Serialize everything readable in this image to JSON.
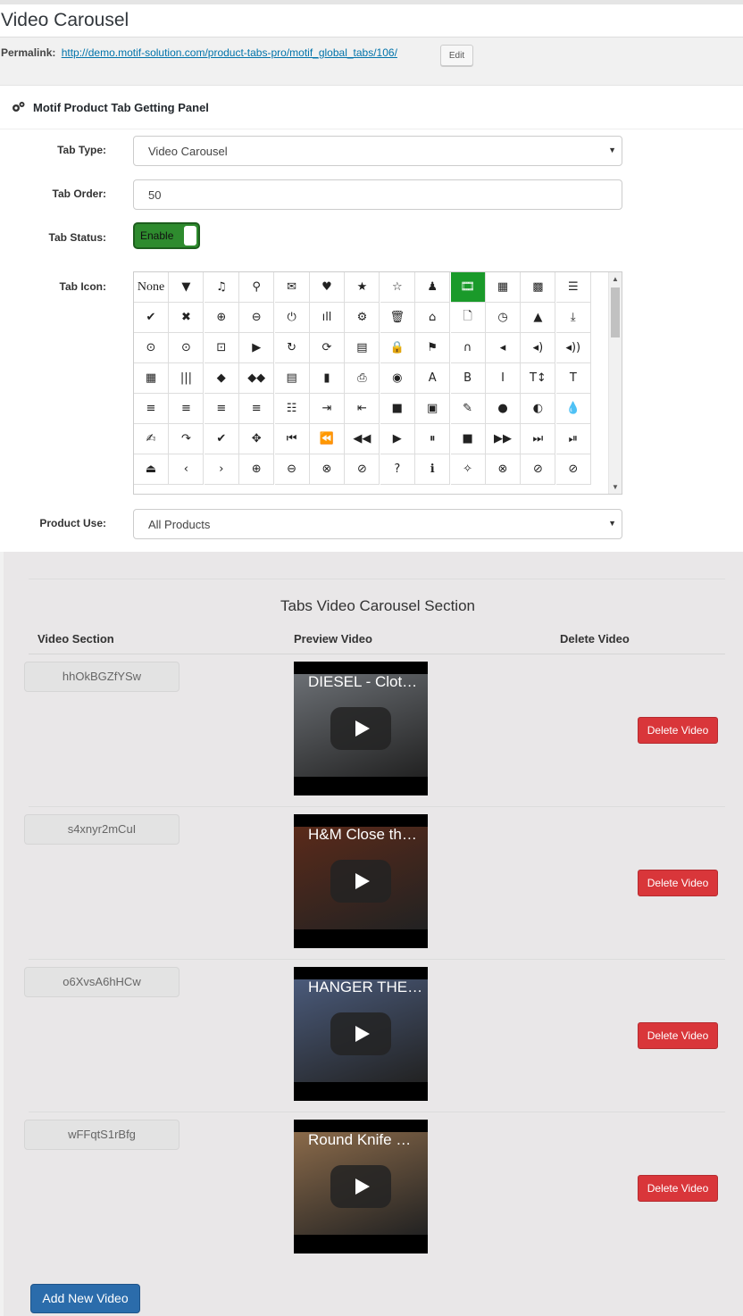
{
  "page_title": "Video Carousel",
  "permalink": {
    "label": "Permalink:",
    "url": "http://demo.motif-solution.com/product-tabs-pro/motif_global_tabs/106/",
    "edit": "Edit"
  },
  "panel_title": "Motif Product Tab Getting Panel",
  "form": {
    "tab_type_label": "Tab Type:",
    "tab_type_value": "Video Carousel",
    "tab_order_label": "Tab Order:",
    "tab_order_value": "50",
    "tab_status_label": "Tab Status:",
    "tab_status_value": "Enable",
    "tab_icon_label": "Tab Icon:",
    "product_use_label": "Product Use:",
    "product_use_value": "All Products"
  },
  "icons": [
    [
      "None",
      "▼",
      "♫",
      "⚲",
      "✉",
      "♥",
      "★",
      "☆",
      "♟",
      "🎞",
      "▦",
      "▩",
      "☰"
    ],
    [
      "✔",
      "✖",
      "⊕",
      "⊖",
      "⏻",
      "ıll",
      "⚙",
      "🗑",
      "⌂",
      "🗋",
      "◷",
      "▲",
      "⤓"
    ],
    [
      "⊙",
      "⊙",
      "⊡",
      "▶",
      "↻",
      "⟳",
      "▤",
      "🔒",
      "⚑",
      "∩",
      "◂",
      "◂)",
      "◂))"
    ],
    [
      "▦",
      "|||",
      "◆",
      "◆◆",
      "▤",
      "▮",
      "⎙",
      "◉",
      "A",
      "B",
      "I",
      "T↕",
      "T"
    ],
    [
      "≡",
      "≡",
      "≡",
      "≡",
      "☷",
      "⇥",
      "⇤",
      "■",
      "▣",
      "✎",
      "●",
      "◐",
      "💧"
    ],
    [
      "✍",
      "↷",
      "✔",
      "✥",
      "⏮",
      "⏪",
      "◀◀",
      "▶",
      "⏸",
      "■",
      "▶▶",
      "⏭",
      "⏯"
    ],
    [
      "⏏",
      "‹",
      "›",
      "⊕",
      "⊖",
      "⊗",
      "⊘",
      "?",
      "ℹ",
      "✧",
      "⊗",
      "⊘",
      "⊘"
    ]
  ],
  "selected_icon": "🎞",
  "video_section": {
    "title": "Tabs Video Carousel Section",
    "col_video": "Video Section",
    "col_preview": "Preview Video",
    "col_delete": "Delete Video",
    "rows": [
      {
        "id": "hhOkBGZfYSw",
        "caption": "DIESEL - Clot…",
        "delete": "Delete Video",
        "bg": "#6b6f74"
      },
      {
        "id": "s4xnyr2mCuI",
        "caption": "H&M Close th…",
        "delete": "Delete Video",
        "bg": "#5a2a1a"
      },
      {
        "id": "o6XvsA6hHCw",
        "caption": "HANGER THE…",
        "delete": "Delete Video",
        "bg": "#4a5a7a"
      },
      {
        "id": "wFFqtS1rBfg",
        "caption": "Round Knife …",
        "delete": "Delete Video",
        "bg": "#8a6a4a"
      }
    ],
    "add_button": "Add New Video"
  }
}
